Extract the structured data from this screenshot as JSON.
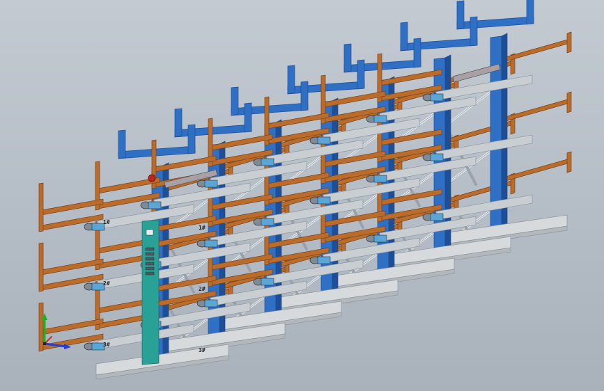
{
  "view": {
    "background_top": "#c3cad2",
    "background_bottom": "#a9b1bb"
  },
  "colors": {
    "column_blue": "#2f6fc4",
    "column_blue_dark": "#1d4e96",
    "arm_wood": "#b96c2c",
    "arm_wood_dark": "#7d4214",
    "steel": "#c9ced3",
    "steel_dark": "#8d959d",
    "base_gray": "#d7dadc",
    "panel_teal": "#2aa197",
    "axis_x": "#1f3fd6",
    "axis_y": "#18b51f",
    "axis_z": "#d42a2a",
    "marker_red": "#c0221c"
  },
  "scene": {
    "column_count": 7,
    "arm_levels": 3,
    "level_labels": [
      "1#",
      "2#",
      "3#"
    ],
    "icons": [
      "triad-axis-icon"
    ]
  }
}
